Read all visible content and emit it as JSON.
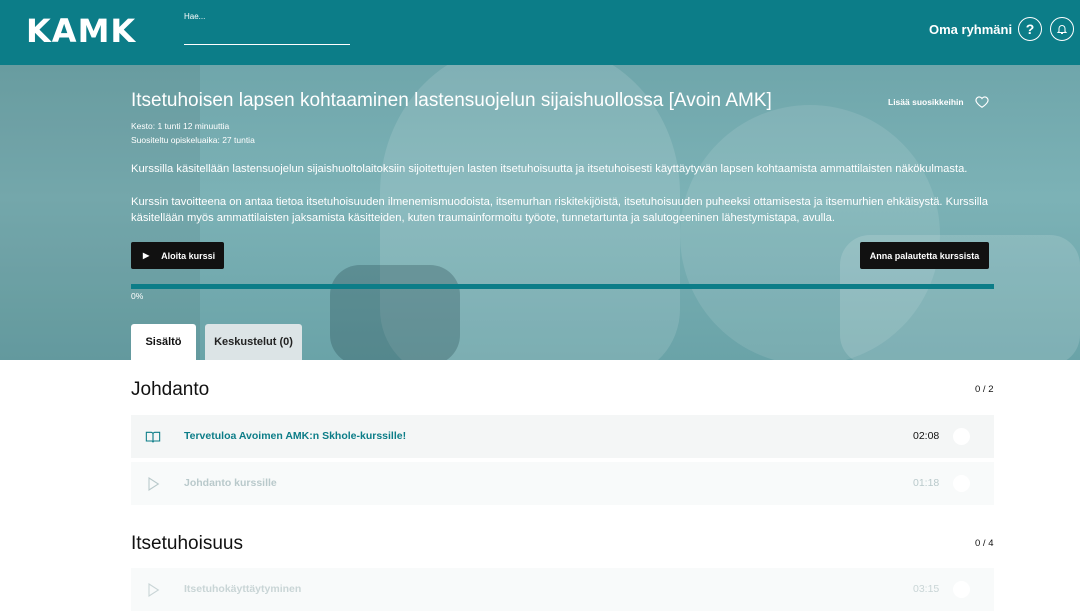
{
  "header": {
    "logo": "KAMK",
    "search_label": "Hae...",
    "search_value": "",
    "group_link": "Oma ryhmäni",
    "help_glyph": "?"
  },
  "course": {
    "title": "Itsetuhoisen lapsen kohtaaminen lastensuojelun sijaishuollossa [Avoin AMK]",
    "favorite_label": "Lisää suosikkeihin",
    "duration": "Kesto: 1 tunti 12 minuuttia",
    "recommended": "Suositeltu opiskeluaika: 27 tuntia",
    "description_1": "Kurssilla käsitellään lastensuojelun sijaishuoltolaitoksiin sijoitettujen lasten itsetuhoisuutta ja itsetuhoisesti käyttäytyvän lapsen kohtaamista ammattilaisten näkökulmasta.",
    "description_2": "Kurssin tavoitteena on antaa tietoa itsetuhoisuuden ilmenemismuodoista, itsemurhan riskitekijöistä, itsetuhoisuuden puheeksi ottamisesta ja itsemurhien ehkäisystä. Kurssilla käsitellään myös ammattilaisten jaksamista käsitteiden, kuten traumainformoitu työote, tunnetartunta ja salutogeeninen lähestymistapa, avulla.",
    "start_button": "Aloita kurssi",
    "feedback_button": "Anna palautetta kurssista",
    "progress_percent": 0,
    "progress_label": "0%"
  },
  "tabs": [
    {
      "label": "Sisältö",
      "active": true
    },
    {
      "label": "Keskustelut (0)",
      "active": false
    }
  ],
  "sections": [
    {
      "title": "Johdanto",
      "count": "0 / 2",
      "items": [
        {
          "title": "Tervetuloa Avoimen AMK:n Skhole-kurssille!",
          "time": "02:08",
          "icon": "book-icon"
        },
        {
          "title": "Johdanto kurssille",
          "time": "01:18",
          "icon": "play-icon"
        }
      ]
    },
    {
      "title": "Itsetuhoisuus",
      "count": "0 / 4",
      "items": [
        {
          "title": "Itsetuhokäyttäytyminen",
          "time": "03:15",
          "icon": "play-icon"
        }
      ]
    }
  ],
  "colors": {
    "brand": "#0c7d88",
    "link": "#0c7d88"
  }
}
